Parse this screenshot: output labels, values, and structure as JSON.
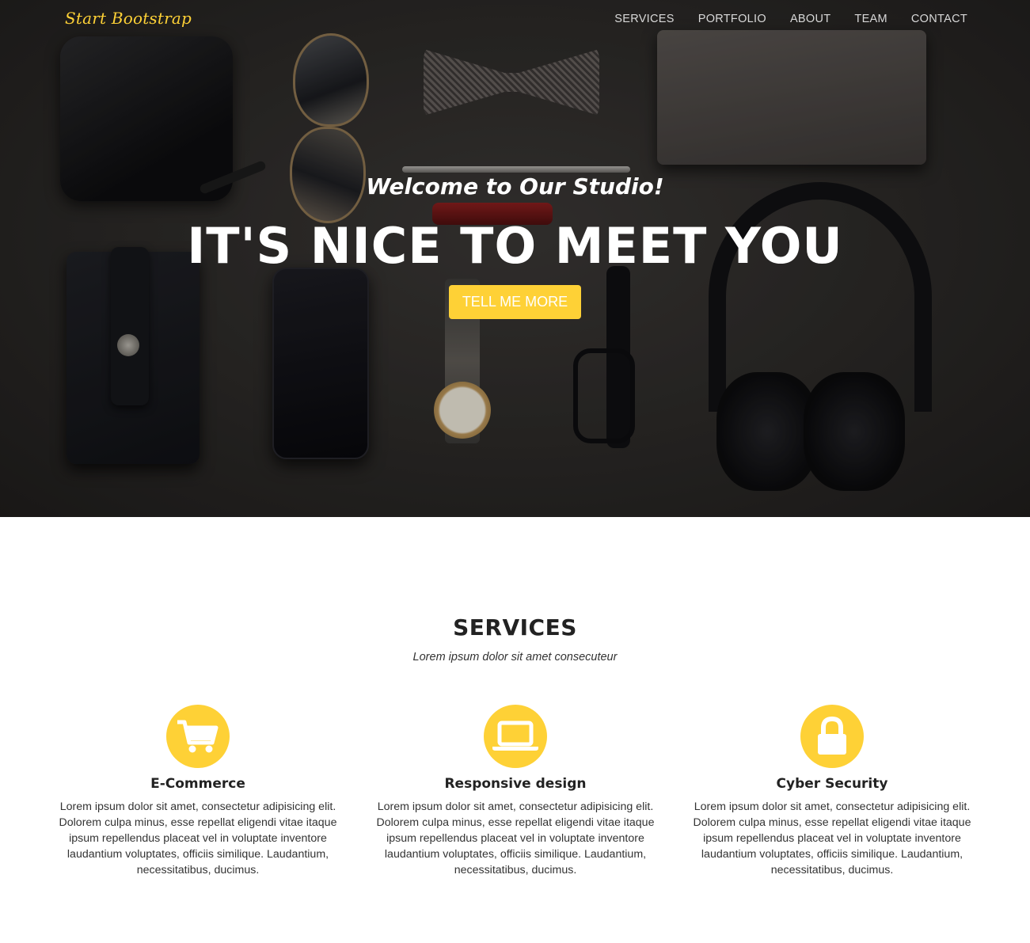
{
  "nav": {
    "brand": "Start Bootstrap",
    "links": [
      "SERVICES",
      "PORTFOLIO",
      "ABOUT",
      "TEAM",
      "CONTACT"
    ]
  },
  "hero": {
    "subtitle": "Welcome to Our Studio!",
    "title": "IT'S NICE TO MEET YOU",
    "button": "TELL ME MORE"
  },
  "services": {
    "title": "SERVICES",
    "subtitle": "Lorem ipsum dolor sit amet consecuteur",
    "items": [
      {
        "icon": "shopping-cart-icon",
        "name": "E-Commerce",
        "text": "Lorem ipsum dolor sit amet, consectetur adipisicing elit. Dolorem culpa minus, esse repellat eligendi vitae itaque ipsum repellendus placeat vel in voluptate inventore laudantium voluptates, officiis similique. Laudantium, necessitatibus, ducimus."
      },
      {
        "icon": "laptop-icon",
        "name": "Responsive design",
        "text": "Lorem ipsum dolor sit amet, consectetur adipisicing elit. Dolorem culpa minus, esse repellat eligendi vitae itaque ipsum repellendus placeat vel in voluptate inventore laudantium voluptates, officiis similique. Laudantium, necessitatibus, ducimus."
      },
      {
        "icon": "lock-icon",
        "name": "Cyber Security",
        "text": "Lorem ipsum dolor sit amet, consectetur adipisicing elit. Dolorem culpa minus, esse repellat eligendi vitae itaque ipsum repellendus placeat vel in voluptate inventore laudantium voluptates, officiis similique. Laudantium, necessitatibus, ducimus."
      }
    ]
  },
  "colors": {
    "accent": "#fed136",
    "heading": "#222222",
    "text": "#333333"
  }
}
